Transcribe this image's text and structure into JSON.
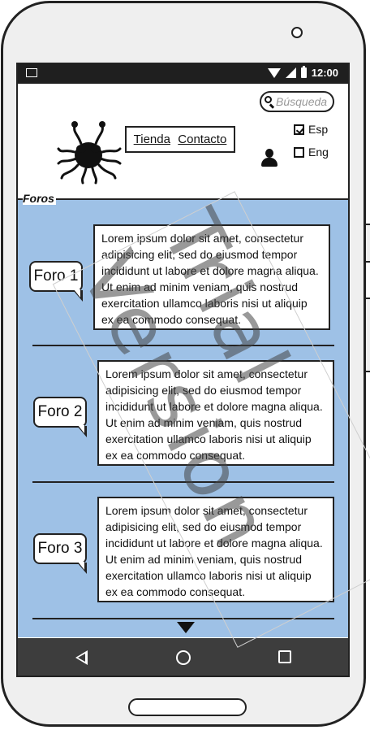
{
  "status_bar": {
    "time": "12:00"
  },
  "header": {
    "search": {
      "placeholder": "Búsqueda"
    },
    "nav": {
      "items": [
        "Tienda",
        "Contacto"
      ]
    },
    "languages": [
      {
        "label": "Esp",
        "checked": true
      },
      {
        "label": "Eng",
        "checked": false
      }
    ]
  },
  "forums": {
    "section_label": "Foros",
    "items": [
      {
        "title": "Foro 1",
        "text": "Lorem ipsum dolor sit amet, consectetur adipisicing elit, sed do eiusmod tempor incididunt ut labore et dolore magna aliqua. Ut enim ad minim veniam, quis nostrud exercitation ullamco laboris nisi ut aliquip ex ea commodo consequat."
      },
      {
        "title": "Foro 2",
        "text": "Lorem ipsum dolor sit amet, consectetur adipisicing elit, sed do eiusmod tempor incididunt ut labore et dolore magna aliqua. Ut enim ad minim veniam, quis nostrud exercitation ullamco laboris nisi ut aliquip ex ea commodo consequat."
      },
      {
        "title": "Foro 3",
        "text": "Lorem ipsum dolor sit amet, consectetur adipisicing elit, sed do eiusmod tempor incididunt ut labore et dolore magna aliqua. Ut enim ad minim veniam, quis nostrud exercitation ullamco laboris nisi ut aliquip ex ea commodo consequat."
      }
    ]
  },
  "watermark": "Trial Version",
  "colors": {
    "panel": "#9ec1e6",
    "navbar": "#3d3d3d",
    "statusbar": "#1f1f1f"
  }
}
